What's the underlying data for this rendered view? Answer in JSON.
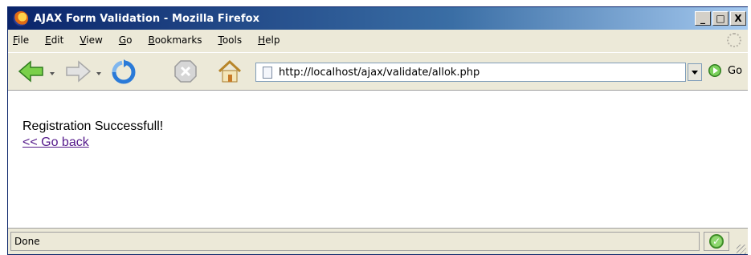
{
  "window": {
    "title": "AJAX Form Validation - Mozilla Firefox",
    "minimize_label": "_",
    "maximize_label": "□",
    "close_label": "X"
  },
  "menu": {
    "items": [
      {
        "first": "F",
        "rest": "ile"
      },
      {
        "first": "E",
        "rest": "dit"
      },
      {
        "first": "V",
        "rest": "iew"
      },
      {
        "first": "G",
        "rest": "o"
      },
      {
        "first": "B",
        "rest": "ookmarks"
      },
      {
        "first": "T",
        "rest": "ools"
      },
      {
        "first": "H",
        "rest": "elp"
      }
    ]
  },
  "toolbar": {
    "icons": [
      "back-arrow-icon",
      "forward-arrow-icon",
      "reload-icon",
      "stop-icon",
      "home-icon"
    ],
    "url": "http://localhost/ajax/validate/allok.php",
    "go_label": "Go"
  },
  "page": {
    "message": "Registration Successfull!",
    "back_link": "<< Go back"
  },
  "status": {
    "text": "Done"
  },
  "colors": {
    "titlebar": "#0a246a",
    "link": "#551a8b",
    "chrome": "#ece9d8"
  }
}
